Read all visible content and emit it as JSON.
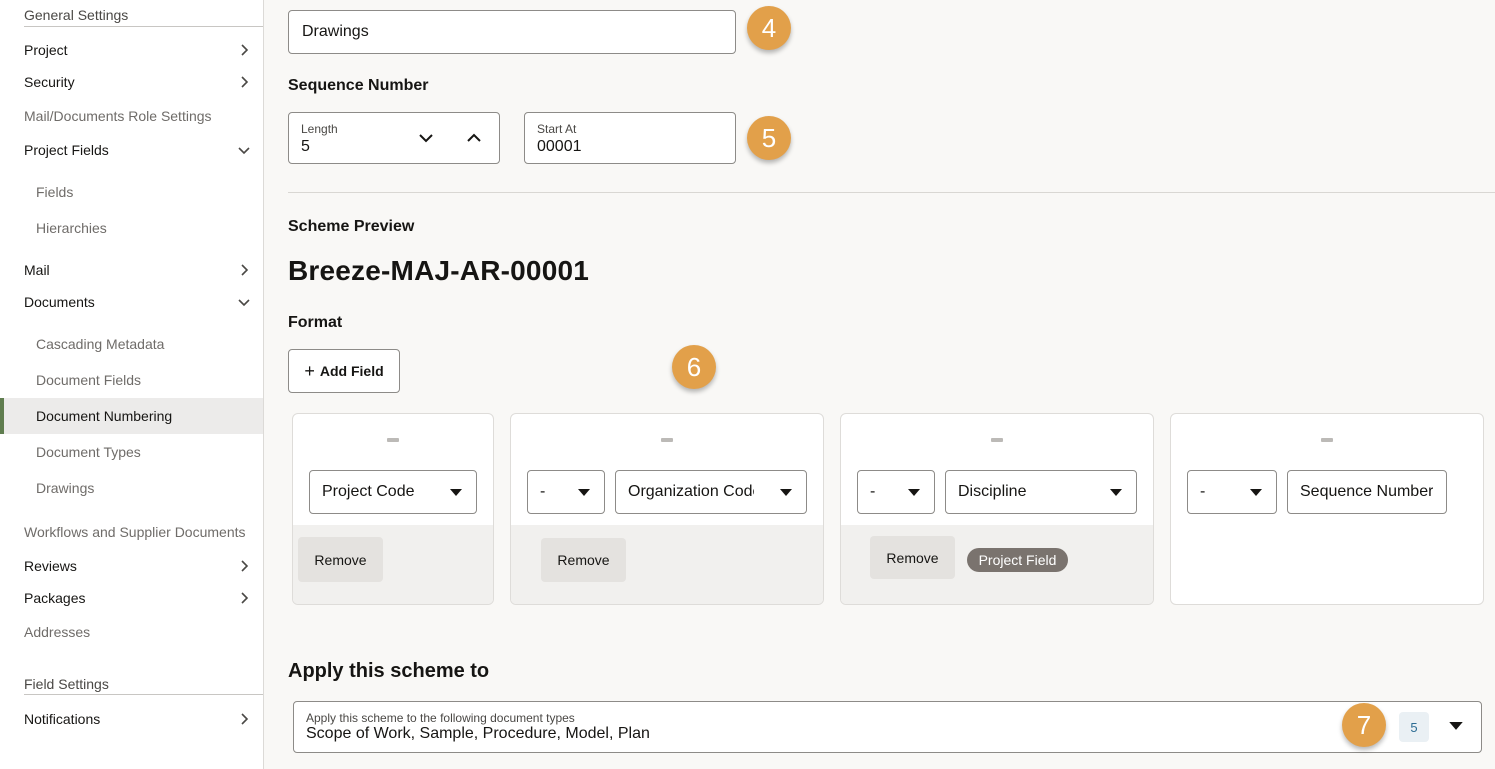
{
  "sidebar": {
    "general_settings": "General Settings",
    "field_settings": "Field Settings",
    "items": [
      {
        "label": "Project"
      },
      {
        "label": "Security"
      },
      {
        "label": "Mail/Documents Role Settings"
      },
      {
        "label": "Project Fields"
      },
      {
        "label": "Fields"
      },
      {
        "label": "Hierarchies"
      },
      {
        "label": "Mail"
      },
      {
        "label": "Documents"
      },
      {
        "label": "Cascading Metadata"
      },
      {
        "label": "Document Fields"
      },
      {
        "label": "Document Numbering"
      },
      {
        "label": "Document Types"
      },
      {
        "label": "Drawings"
      },
      {
        "label": "Workflows and Supplier Documents"
      },
      {
        "label": "Reviews"
      },
      {
        "label": "Packages"
      },
      {
        "label": "Addresses"
      },
      {
        "label": "Notifications"
      }
    ]
  },
  "scheme_name": {
    "value": "Drawings"
  },
  "sequence": {
    "title": "Sequence Number",
    "length_label": "Length",
    "length_value": "5",
    "start_label": "Start At",
    "start_value": "00001"
  },
  "preview": {
    "title": "Scheme Preview",
    "value": "Breeze-MAJ-AR-00001"
  },
  "format": {
    "title": "Format",
    "add_field": "Add Field",
    "remove_label": "Remove",
    "separator_value": "-",
    "fields": [
      {
        "value": "Project Code"
      },
      {
        "value": "Organization Code"
      },
      {
        "value": "Discipline",
        "tag": "Project Field"
      },
      {
        "value": "Sequence Number"
      }
    ]
  },
  "apply": {
    "title": "Apply this scheme to",
    "field_label": "Apply this scheme to the following document types",
    "field_value": "Scope of Work, Sample, Procedure, Model, Plan",
    "count": "5"
  },
  "badges": [
    "4",
    "5",
    "6",
    "7"
  ],
  "colors": {
    "accent_bar": "#5f7d4f",
    "badge": "#e2a04a",
    "tag": "#7a736e"
  }
}
